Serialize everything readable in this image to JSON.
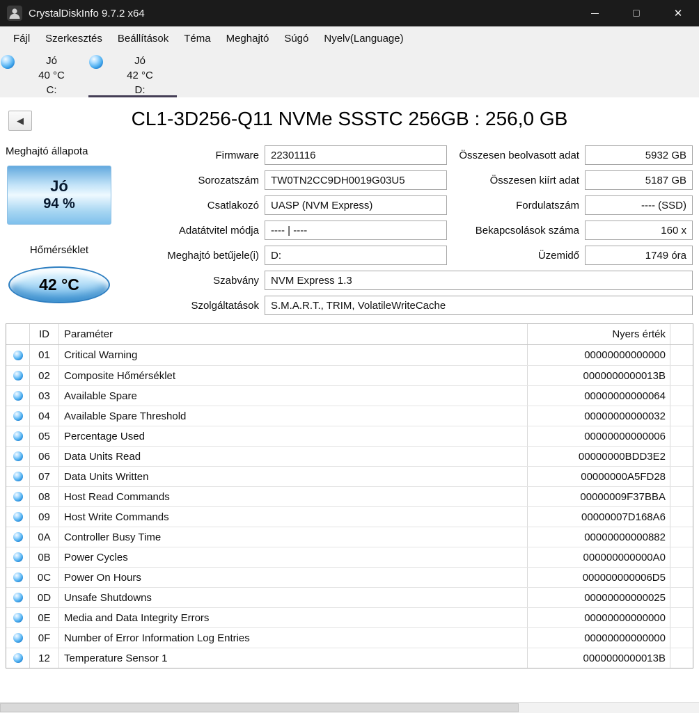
{
  "colors": {
    "titlebar_bg": "#1b1b1b",
    "status_good_blue": "#1272c8",
    "tab_underline": "#443e55",
    "health_gradient_top": "#63a9de",
    "health_gradient_bottom": "#7fc0ec"
  },
  "window": {
    "title": "CrystalDiskInfo 9.7.2 x64"
  },
  "icons": {
    "back": "◀",
    "minimize": "—",
    "maximize": "□",
    "close": "✕",
    "status_good": "blue-orb"
  },
  "menu": {
    "items": [
      "Fájl",
      "Szerkesztés",
      "Beállítások",
      "Téma",
      "Meghajtó",
      "Súgó",
      "Nyelv(Language)"
    ]
  },
  "drive_tabs": [
    {
      "status": "Jó",
      "temp": "40 °C",
      "letter": "C:",
      "selected": false
    },
    {
      "status": "Jó",
      "temp": "42 °C",
      "letter": "D:",
      "selected": true
    }
  ],
  "drive_title": "CL1-3D256-Q11 NVMe SSSTC 256GB : 256,0 GB",
  "health": {
    "label": "Meghajtó állapota",
    "status": "Jó",
    "percent": "94 %"
  },
  "temperature": {
    "label": "Hőmérséklet",
    "value": "42 °C"
  },
  "info_rows": [
    {
      "left_label": "Firmware",
      "left_value": "22301116",
      "right_label": "Összesen beolvasott adat",
      "right_value": "5932 GB"
    },
    {
      "left_label": "Sorozatszám",
      "left_value": "TW0TN2CC9DH0019G03U5",
      "right_label": "Összesen kiírt adat",
      "right_value": "5187 GB"
    },
    {
      "left_label": "Csatlakozó",
      "left_value": "UASP (NVM Express)",
      "right_label": "Fordulatszám",
      "right_value": "---- (SSD)"
    },
    {
      "left_label": "Adatátvitel módja",
      "left_value": "---- | ----",
      "right_label": "Bekapcsolások száma",
      "right_value": "160 x"
    },
    {
      "left_label": "Meghajtó betűjele(i)",
      "left_value": "D:",
      "right_label": "Üzemidő",
      "right_value": "1749 óra"
    },
    {
      "left_label": "Szabvány",
      "left_value": "NVM Express 1.3",
      "full": true
    },
    {
      "left_label": "Szolgáltatások",
      "left_value": "S.M.A.R.T., TRIM, VolatileWriteCache",
      "full": true
    }
  ],
  "smart_table": {
    "headers": {
      "id": "ID",
      "param": "Paraméter",
      "raw": "Nyers érték"
    },
    "rows": [
      {
        "id": "01",
        "param": "Critical Warning",
        "raw": "00000000000000"
      },
      {
        "id": "02",
        "param": "Composite Hőmérséklet",
        "raw": "0000000000013B"
      },
      {
        "id": "03",
        "param": "Available Spare",
        "raw": "00000000000064"
      },
      {
        "id": "04",
        "param": "Available Spare Threshold",
        "raw": "00000000000032"
      },
      {
        "id": "05",
        "param": "Percentage Used",
        "raw": "00000000000006"
      },
      {
        "id": "06",
        "param": "Data Units Read",
        "raw": "00000000BDD3E2"
      },
      {
        "id": "07",
        "param": "Data Units Written",
        "raw": "00000000A5FD28"
      },
      {
        "id": "08",
        "param": "Host Read Commands",
        "raw": "00000009F37BBA"
      },
      {
        "id": "09",
        "param": "Host Write Commands",
        "raw": "00000007D168A6"
      },
      {
        "id": "0A",
        "param": "Controller Busy Time",
        "raw": "00000000000882"
      },
      {
        "id": "0B",
        "param": "Power Cycles",
        "raw": "000000000000A0"
      },
      {
        "id": "0C",
        "param": "Power On Hours",
        "raw": "000000000006D5"
      },
      {
        "id": "0D",
        "param": "Unsafe Shutdowns",
        "raw": "00000000000025"
      },
      {
        "id": "0E",
        "param": "Media and Data Integrity Errors",
        "raw": "00000000000000"
      },
      {
        "id": "0F",
        "param": "Number of Error Information Log Entries",
        "raw": "00000000000000"
      },
      {
        "id": "12",
        "param": "Temperature Sensor 1",
        "raw": "0000000000013B"
      }
    ]
  }
}
